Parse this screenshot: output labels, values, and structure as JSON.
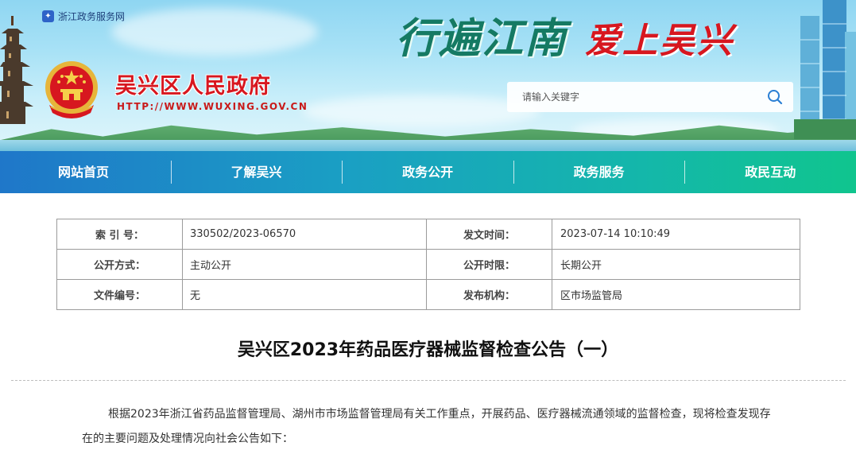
{
  "header": {
    "portal_link": "浙江政务服务网",
    "site_name": "吴兴区人民政府",
    "site_url": "HTTP://WWW.WUXING.GOV.CN",
    "slogan_part1": "行遍江南",
    "slogan_part2": "爱上吴兴",
    "search": {
      "placeholder": "请输入关键字"
    }
  },
  "nav": {
    "items": [
      "网站首页",
      "了解吴兴",
      "政务公开",
      "政务服务",
      "政民互动"
    ]
  },
  "meta": {
    "index_label": "索 引 号：",
    "index_value": "330502/2023-06570",
    "date_label": "发文时间：",
    "date_value": "2023-07-14 10:10:49",
    "method_label": "公开方式：",
    "method_value": "主动公开",
    "period_label": "公开时限：",
    "period_value": "长期公开",
    "docno_label": "文件编号：",
    "docno_value": "无",
    "org_label": "发布机构：",
    "org_value": "区市场监管局"
  },
  "article": {
    "title": "吴兴区2023年药品医疗器械监督检查公告（一）",
    "paragraph": "根据2023年浙江省药品监督管理局、湖州市市场监督管理局有关工作重点，开展药品、医疗器械流通领域的监督检查，现将检查发现存在的主要问题及处理情况向社会公告如下："
  },
  "colors": {
    "title_red": "#d7171f",
    "nav_start": "#1f77c9",
    "nav_end": "#10c58e",
    "slogan_green": "#157a63"
  }
}
